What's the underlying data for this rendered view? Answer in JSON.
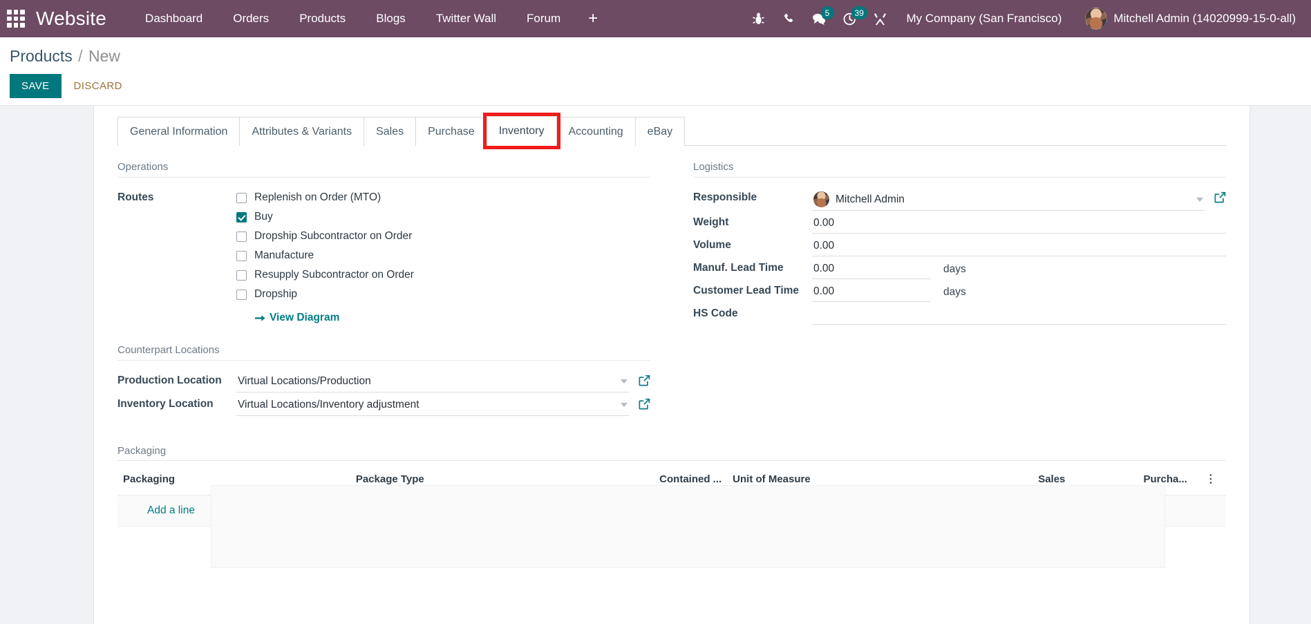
{
  "navbar": {
    "apps_icon": "apps-grid-icon",
    "brand": "Website",
    "menu": [
      {
        "label": "Dashboard"
      },
      {
        "label": "Orders"
      },
      {
        "label": "Products"
      },
      {
        "label": "Blogs"
      },
      {
        "label": "Twitter Wall"
      },
      {
        "label": "Forum"
      }
    ],
    "plus_label": "+",
    "sysicons": [
      {
        "name": "debug-bug-icon",
        "badge": null
      },
      {
        "name": "phone-icon",
        "badge": null
      },
      {
        "name": "messages-icon",
        "badge": "5"
      },
      {
        "name": "activities-clock-icon",
        "badge": "39"
      },
      {
        "name": "developer-tools-icon",
        "badge": null
      }
    ],
    "company": "My Company (San Francisco)",
    "user": "Mitchell Admin (14020999-15-0-all)"
  },
  "control_panel": {
    "breadcrumb_root": "Products",
    "breadcrumb_sep": "/",
    "breadcrumb_current": "New",
    "save_label": "SAVE",
    "discard_label": "DISCARD"
  },
  "tabs": [
    {
      "label": "General Information",
      "active": false
    },
    {
      "label": "Attributes & Variants",
      "active": false
    },
    {
      "label": "Sales",
      "active": false
    },
    {
      "label": "Purchase",
      "active": false
    },
    {
      "label": "Inventory",
      "active": true,
      "highlighted": true
    },
    {
      "label": "Accounting",
      "active": false
    },
    {
      "label": "eBay",
      "active": false
    }
  ],
  "highlight_color": "#ef1c1c",
  "accent_color": "#00787d",
  "navbar_color": "#6d4b63",
  "inventory": {
    "operations": {
      "title": "Operations",
      "routes_label": "Routes",
      "routes": [
        {
          "label": "Replenish on Order (MTO)",
          "checked": false
        },
        {
          "label": "Buy",
          "checked": true
        },
        {
          "label": "Dropship Subcontractor on Order",
          "checked": false
        },
        {
          "label": "Manufacture",
          "checked": false
        },
        {
          "label": "Resupply Subcontractor on Order",
          "checked": false
        },
        {
          "label": "Dropship",
          "checked": false
        }
      ],
      "view_diagram_label": "View Diagram"
    },
    "logistics": {
      "title": "Logistics",
      "responsible_label": "Responsible",
      "responsible_value": "Mitchell Admin",
      "weight_label": "Weight",
      "weight_value": "0.00",
      "volume_label": "Volume",
      "volume_value": "0.00",
      "manuf_lead_time_label": "Manuf. Lead Time",
      "manuf_lead_time_value": "0.00",
      "manuf_lead_time_unit": "days",
      "customer_lead_time_label": "Customer Lead Time",
      "customer_lead_time_value": "0.00",
      "customer_lead_time_unit": "days",
      "hs_code_label": "HS Code",
      "hs_code_value": ""
    },
    "counterpart_locations": {
      "title": "Counterpart Locations",
      "production_label": "Production Location",
      "production_value": "Virtual Locations/Production",
      "inventory_label": "Inventory Location",
      "inventory_value": "Virtual Locations/Inventory adjustment"
    },
    "packaging": {
      "title": "Packaging",
      "columns": [
        "Packaging",
        "Package Type",
        "Contained ...",
        "Unit of Measure",
        "Sales",
        "Purcha...",
        "options-icon"
      ],
      "add_line_label": "Add a line",
      "rows": []
    }
  }
}
